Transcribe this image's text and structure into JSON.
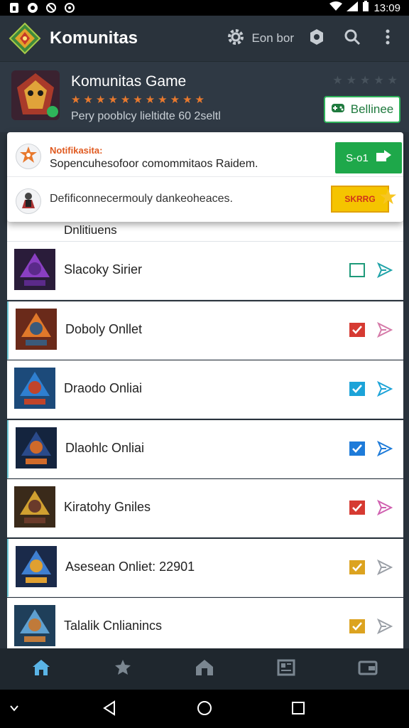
{
  "status_bar": {
    "time": "13:09"
  },
  "app_bar": {
    "title": "Komunitas",
    "action_text": "Eon bor"
  },
  "game": {
    "title": "Komunitas Game",
    "rating_stars": 11,
    "subtitle": "Pery pooblcy lieltidte 60 2seltl",
    "button_label": "Bellinee"
  },
  "notifications": [
    {
      "title": "Notifikasita:",
      "text": "Sopencuhesofoor comommitaos Raidem.",
      "action_label": "S-o1"
    },
    {
      "text": "Defificonnecermouly dankeoheaces.",
      "action_label": "SKRRG"
    }
  ],
  "partial_item": {
    "label": "Dnlitiuens"
  },
  "items": [
    {
      "label": "Slacoky Sirier",
      "checked": false,
      "check_color": "#1e9a7a",
      "send_color": "#1fa3a8"
    },
    {
      "label": "Doboly Onllet",
      "checked": true,
      "check_color": "#d63a32",
      "send_color": "#d57aa8"
    },
    {
      "label": "Draodo Onliai",
      "checked": true,
      "check_color": "#1ca3d8",
      "send_color": "#1ca3d8"
    },
    {
      "label": "Dlaohlc Onliai",
      "checked": true,
      "check_color": "#1e7bd9",
      "send_color": "#1e7bd9"
    },
    {
      "label": "Kiratohy Gniles",
      "checked": true,
      "check_color": "#d63a32",
      "send_color": "#d060b0"
    },
    {
      "label": "Asesean Onliet:  22901",
      "checked": true,
      "check_color": "#dca320",
      "send_color": "#9a9fa6"
    },
    {
      "label": "Talalik Cnlianincs",
      "checked": true,
      "check_color": "#dca320",
      "send_color": "#9a9fa6"
    }
  ],
  "bottom_nav": [
    {
      "name": "home-icon"
    },
    {
      "name": "leaderboard-icon"
    },
    {
      "name": "shop-icon"
    },
    {
      "name": "news-icon"
    },
    {
      "name": "wallet-icon"
    }
  ],
  "colors": {
    "accent": "#e8792e",
    "active_nav": "#5ab4e6",
    "primary_green": "#1ea84a"
  }
}
